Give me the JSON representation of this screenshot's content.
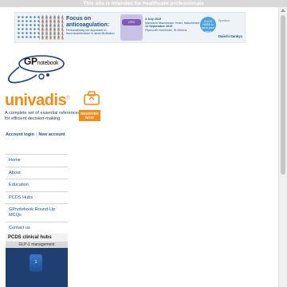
{
  "top_notice": "This site is intended for healthcare professionals",
  "banner": {
    "title_line1": "Focus on",
    "title_line2": "anticoagulation:",
    "subtitle": "Personalising our approach to thromboembolism in atrial fibrillation",
    "badge": "CPD",
    "dates_line1": "3 July 2019",
    "dates_line2": "Mandarin Manchester Hotel, Manchester",
    "dates_line3": "12 September 2019",
    "dates_line4": "Plymouth Hoe/Hotel, St Helens",
    "click_label": "CLICK HERE to book your place",
    "sponsor1": "Sponsor",
    "sponsor2": "Daiichi-Sankyo"
  },
  "gp_logo": {
    "main": "GP",
    "small": "notebook"
  },
  "univadis": {
    "brand": "univadis",
    "mark": "®",
    "tagline": "A complete set of essential references for efficient decision-making",
    "register": "REGISTER NOW"
  },
  "account": {
    "login": "Account login",
    "separator": "|",
    "new": "New account"
  },
  "nav": {
    "items": [
      {
        "label": "Home"
      },
      {
        "label": "About"
      },
      {
        "label": "Education"
      },
      {
        "label": "PCDS Hubs"
      },
      {
        "label": "GPnotebook Round-Up MCQs"
      },
      {
        "label": "Contact us"
      }
    ]
  },
  "pcds": {
    "title": "PCDS clinical hubs",
    "subtitle": "GLP-1 management",
    "pen_number": "1"
  },
  "colors": {
    "brand_orange": "#f28c1b",
    "link_blue": "#1e4f9c",
    "pcds_navy": "#1e3f70"
  }
}
